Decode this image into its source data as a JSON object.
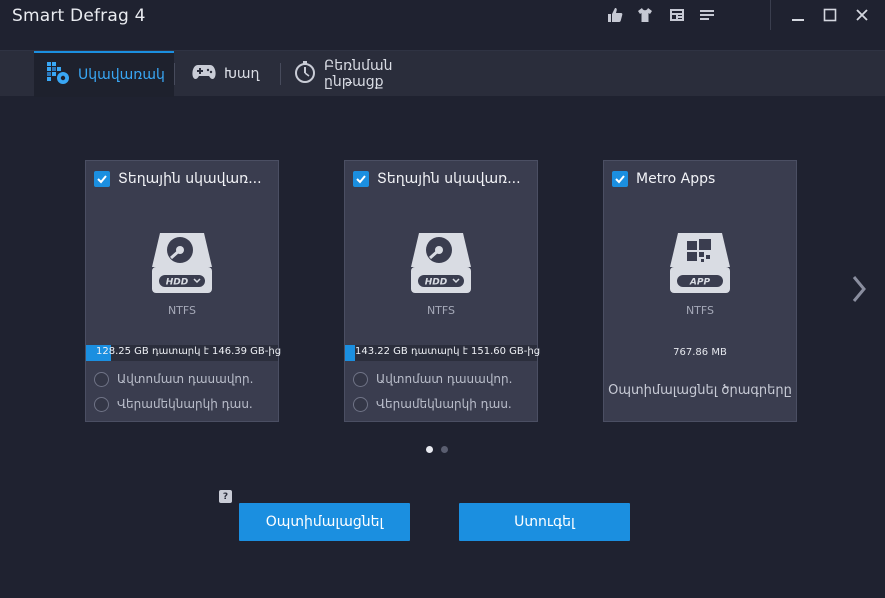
{
  "window": {
    "title": "Smart Defrag 4",
    "toolbar_icons": [
      "thumbs-up-icon",
      "tshirt-icon",
      "news-icon",
      "menu-icon"
    ],
    "controls": [
      "minimize-icon",
      "maximize-icon",
      "close-icon"
    ]
  },
  "tabs": [
    {
      "label": "Սկավառակ",
      "icon": "defrag-icon",
      "active": true
    },
    {
      "label": "Խաղ",
      "icon": "gamepad-icon",
      "active": false
    },
    {
      "label": "Բեռնման ընթացք",
      "icon": "stopwatch-icon",
      "active": false
    }
  ],
  "cards": [
    {
      "title": "Տեղային սկավառ...",
      "checked": true,
      "badge": "HDD",
      "filesystem": "NTFS",
      "usage_text": "128.25 GB դատարկ է 146.39 GB-ից",
      "free_fraction": 0.876,
      "options": [
        "Ավտոմատ դասավոր.",
        "Վերամեկնարկի դաս."
      ]
    },
    {
      "title": "Տեղային սկավառ...",
      "checked": true,
      "badge": "HDD",
      "filesystem": "NTFS",
      "usage_text": "143.22 GB դատարկ է 151.60 GB-ից",
      "free_fraction": 0.945,
      "options": [
        "Ավտոմատ դասավոր.",
        "Վերամեկնարկի դաս."
      ]
    },
    {
      "title": "Metro Apps",
      "checked": true,
      "badge": "APP",
      "filesystem": "NTFS",
      "size": "767.86 MB",
      "action": "Օպտիմալացնել ծրագրերը"
    }
  ],
  "pagination": {
    "current": 1,
    "total": 2
  },
  "buttons": {
    "optimize": "Օպտիմալացնել",
    "analyze": "Ստուգել"
  },
  "colors": {
    "accent": "#1b8fe0",
    "background": "#1f2230",
    "card": "#3a3d4f"
  }
}
